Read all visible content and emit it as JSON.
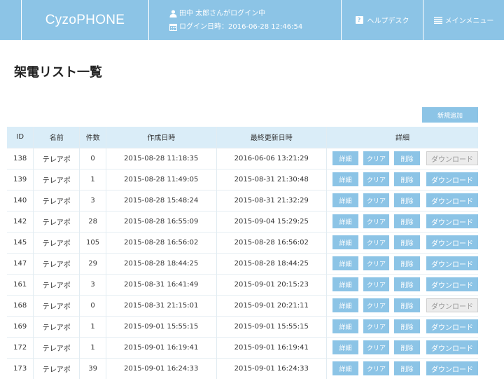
{
  "header": {
    "logo": "CyzoPHONE",
    "login_user": "田中 太郎さんがログイン中",
    "login_time": "ログイン日時：2016-06-28 12:46:54",
    "help_label": "ヘルプデスク",
    "menu_label": "メインメニュー",
    "accent_color": "#8cc4e6"
  },
  "page": {
    "title": "架電リスト一覧",
    "new_button": "新規追加"
  },
  "table": {
    "headers": {
      "id": "ID",
      "name": "名前",
      "count": "件数",
      "created": "作成日時",
      "updated": "最終更新日時",
      "detail": "詳細"
    },
    "action_labels": {
      "detail": "詳細",
      "clear": "クリア",
      "delete": "削除",
      "download": "ダウンロード"
    },
    "rows": [
      {
        "id": "138",
        "name": "テレアポ",
        "count": "0",
        "created": "2015-08-28 11:18:35",
        "updated": "2016-06-06 13:21:29",
        "download_enabled": false
      },
      {
        "id": "139",
        "name": "テレアポ",
        "count": "1",
        "created": "2015-08-28 11:49:05",
        "updated": "2015-08-31 21:30:48",
        "download_enabled": true
      },
      {
        "id": "140",
        "name": "テレアポ",
        "count": "3",
        "created": "2015-08-28 15:48:24",
        "updated": "2015-08-31 21:32:29",
        "download_enabled": true
      },
      {
        "id": "142",
        "name": "テレアポ",
        "count": "28",
        "created": "2015-08-28 16:55:09",
        "updated": "2015-09-04 15:29:25",
        "download_enabled": true
      },
      {
        "id": "145",
        "name": "テレアポ",
        "count": "105",
        "created": "2015-08-28 16:56:02",
        "updated": "2015-08-28 16:56:02",
        "download_enabled": true
      },
      {
        "id": "147",
        "name": "テレアポ",
        "count": "29",
        "created": "2015-08-28 18:44:25",
        "updated": "2015-08-28 18:44:25",
        "download_enabled": true
      },
      {
        "id": "161",
        "name": "テレアポ",
        "count": "3",
        "created": "2015-08-31 16:41:49",
        "updated": "2015-09-01 20:15:23",
        "download_enabled": true
      },
      {
        "id": "168",
        "name": "テレアポ",
        "count": "0",
        "created": "2015-08-31 21:15:01",
        "updated": "2015-09-01 20:21:11",
        "download_enabled": false
      },
      {
        "id": "169",
        "name": "テレアポ",
        "count": "1",
        "created": "2015-09-01 15:55:15",
        "updated": "2015-09-01 15:55:15",
        "download_enabled": true
      },
      {
        "id": "172",
        "name": "テレアポ",
        "count": "1",
        "created": "2015-09-01 16:19:41",
        "updated": "2015-09-01 16:19:41",
        "download_enabled": true
      },
      {
        "id": "173",
        "name": "テレアポ",
        "count": "39",
        "created": "2015-09-01 16:24:33",
        "updated": "2015-09-01 16:24:33",
        "download_enabled": true
      }
    ]
  }
}
